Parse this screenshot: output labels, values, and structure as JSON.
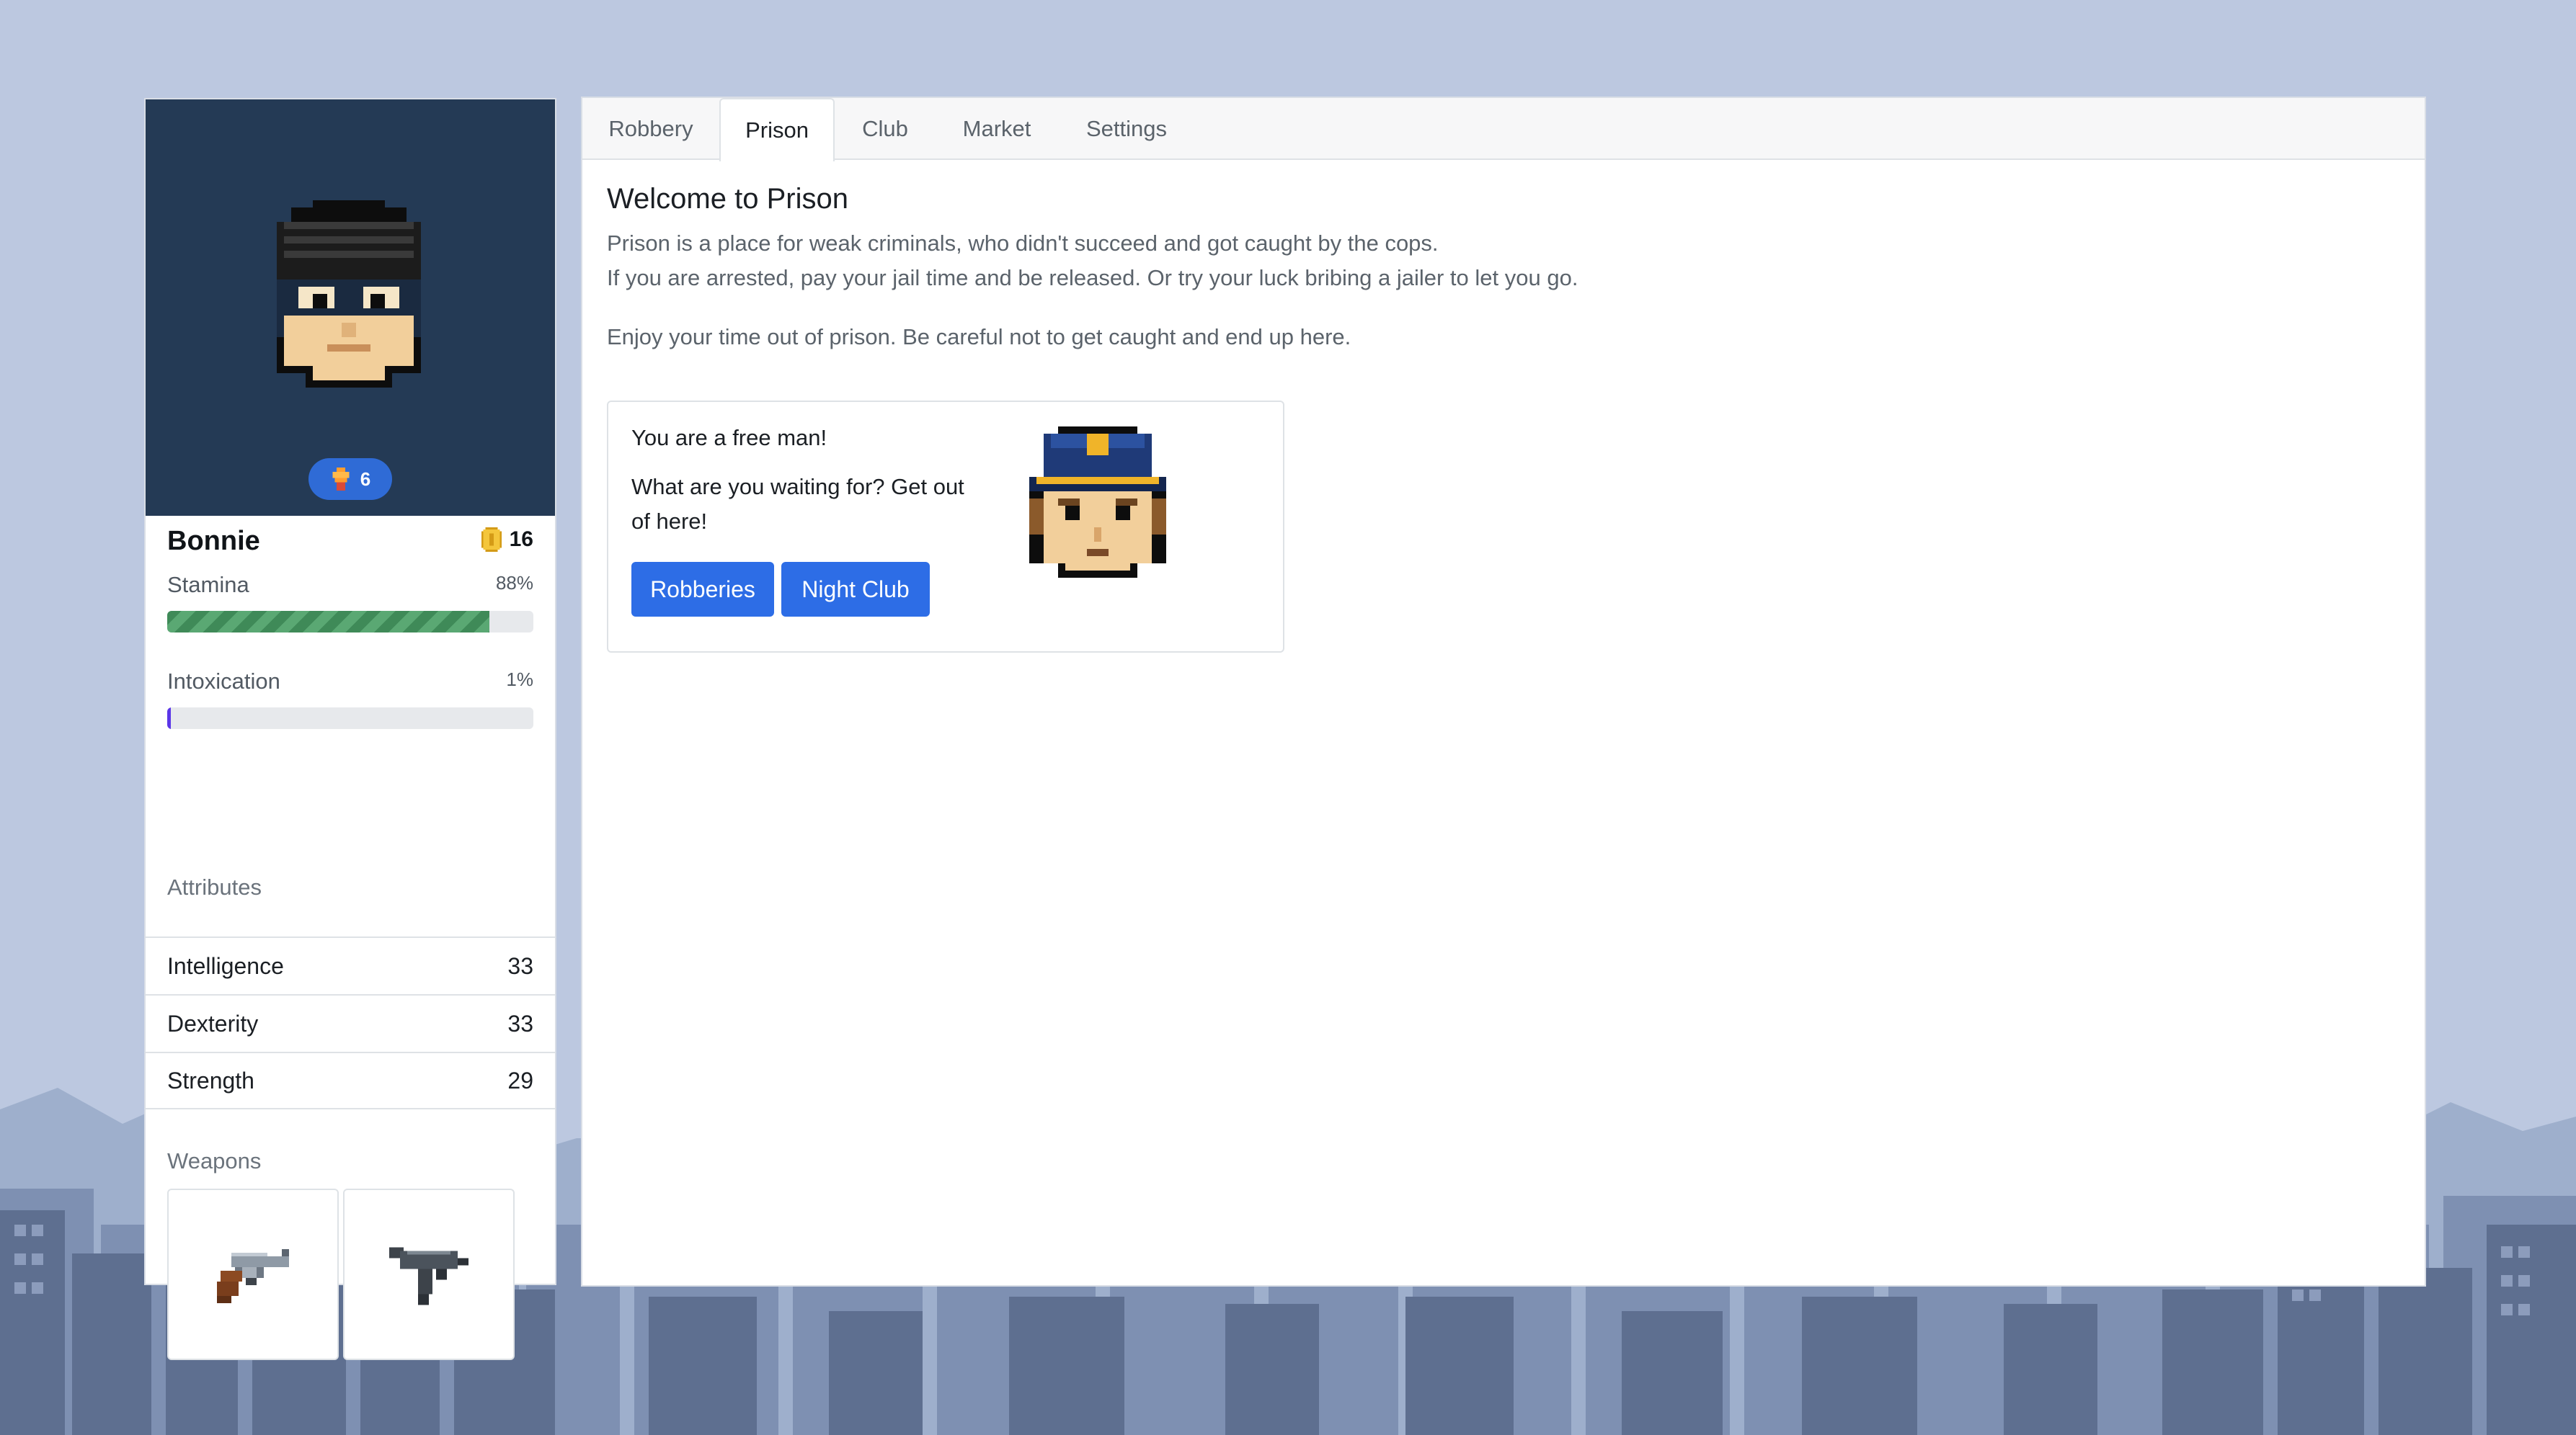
{
  "player": {
    "name": "Bonnie",
    "level": "6",
    "coins": "16",
    "stamina": {
      "label": "Stamina",
      "value_text": "88%",
      "value": 88
    },
    "intoxication": {
      "label": "Intoxication",
      "value_text": "1%",
      "value": 1
    },
    "attributes_title": "Attributes",
    "attributes": [
      {
        "name": "Intelligence",
        "value": "33"
      },
      {
        "name": "Dexterity",
        "value": "33"
      },
      {
        "name": "Strength",
        "value": "29"
      }
    ],
    "weapons_title": "Weapons",
    "weapons": [
      "revolver-icon",
      "uzi-icon"
    ]
  },
  "tabs": [
    {
      "label": "Robbery",
      "active": false
    },
    {
      "label": "Prison",
      "active": true
    },
    {
      "label": "Club",
      "active": false
    },
    {
      "label": "Market",
      "active": false
    },
    {
      "label": "Settings",
      "active": false
    }
  ],
  "prison": {
    "title": "Welcome to Prison",
    "desc_line1": "Prison is a place for weak criminals, who didn't succeed and got caught by the cops.",
    "desc_line2": "If you are arrested, pay your jail time and be released. Or try your luck bribing a jailer to let you go.",
    "desc_line3": "Enjoy your time out of prison. Be careful not to get caught and end up here.",
    "card": {
      "heading": "You are a free man!",
      "text_line1": "What are you waiting for? Get out",
      "text_line2": "of here!",
      "buttons": [
        "Robberies",
        "Night Club"
      ]
    }
  },
  "colors": {
    "accent": "#2d6de6",
    "avatar_panel": "#243a55",
    "stamina_bar": "#4a9864",
    "intoxication_bar": "#5b36e8",
    "background": "#bcc8e0"
  }
}
